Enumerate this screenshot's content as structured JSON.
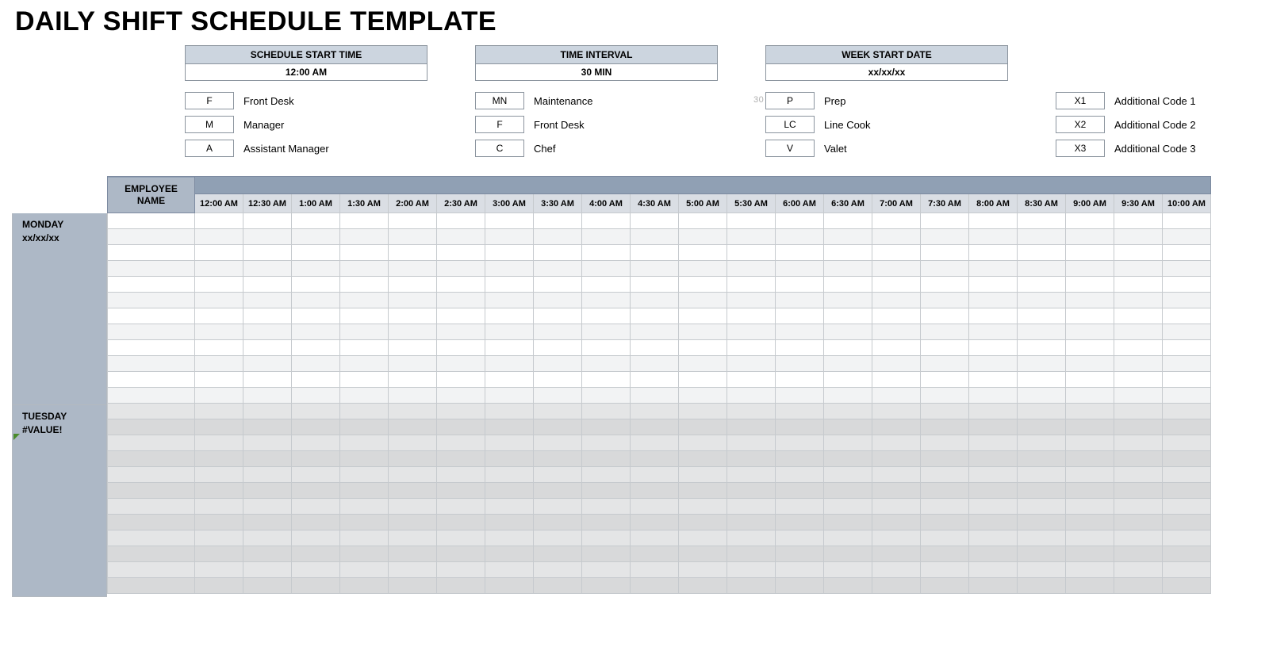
{
  "title": "DAILY SHIFT SCHEDULE TEMPLATE",
  "config": {
    "scheduleStart": {
      "label": "SCHEDULE START TIME",
      "value": "12:00 AM"
    },
    "timeInterval": {
      "label": "TIME INTERVAL",
      "value": "30 MIN"
    },
    "weekStart": {
      "label": "WEEK START DATE",
      "value": "xx/xx/xx"
    }
  },
  "stray_value": "30",
  "legend": {
    "col1": [
      {
        "code": "F",
        "label": "Front Desk"
      },
      {
        "code": "M",
        "label": "Manager"
      },
      {
        "code": "A",
        "label": "Assistant Manager"
      }
    ],
    "col2": [
      {
        "code": "MN",
        "label": "Maintenance"
      },
      {
        "code": "F",
        "label": "Front Desk"
      },
      {
        "code": "C",
        "label": "Chef"
      }
    ],
    "col3": [
      {
        "code": "P",
        "label": "Prep"
      },
      {
        "code": "LC",
        "label": "Line Cook"
      },
      {
        "code": "V",
        "label": "Valet"
      }
    ],
    "col4": [
      {
        "code": "X1",
        "label": "Additional Code 1"
      },
      {
        "code": "X2",
        "label": "Additional Code 2"
      },
      {
        "code": "X3",
        "label": "Additional Code 3"
      }
    ]
  },
  "employee_header": "EMPLOYEE NAME",
  "time_headers": [
    "12:00 AM",
    "12:30 AM",
    "1:00 AM",
    "1:30 AM",
    "2:00 AM",
    "2:30 AM",
    "3:00 AM",
    "3:30 AM",
    "4:00 AM",
    "4:30 AM",
    "5:00 AM",
    "5:30 AM",
    "6:00 AM",
    "6:30 AM",
    "7:00 AM",
    "7:30 AM",
    "8:00 AM",
    "8:30 AM",
    "9:00 AM",
    "9:30 AM",
    "10:00 AM"
  ],
  "days": [
    {
      "name": "MONDAY",
      "date": "xx/xx/xx",
      "error": false,
      "rows": 12
    },
    {
      "name": "TUESDAY",
      "date": "#VALUE!",
      "error": true,
      "rows": 12
    }
  ]
}
